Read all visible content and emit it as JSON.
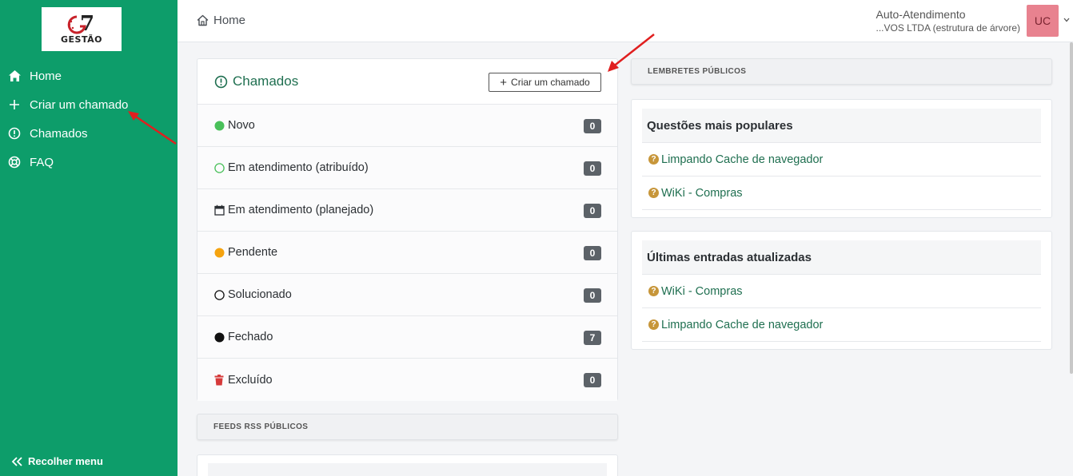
{
  "sidebar": {
    "logo_text": "GESTÃO",
    "logo_mark": "7",
    "items": [
      {
        "label": "Home",
        "icon": "home-icon"
      },
      {
        "label": "Criar um chamado",
        "icon": "plus-icon"
      },
      {
        "label": "Chamados",
        "icon": "alert-circle-icon"
      },
      {
        "label": "FAQ",
        "icon": "lifebuoy-icon"
      }
    ],
    "collapse_label": "Recolher menu"
  },
  "header": {
    "breadcrumb": "Home",
    "user_name": "Auto-Atendimento",
    "user_entity": "...VOS LTDA (estrutura de árvore)",
    "avatar_initials": "UC"
  },
  "tickets": {
    "title": "Chamados",
    "create_label": "Criar um chamado",
    "rows": [
      {
        "label": "Novo",
        "count": "0"
      },
      {
        "label": "Em atendimento (atribuído)",
        "count": "0"
      },
      {
        "label": "Em atendimento (planejado)",
        "count": "0"
      },
      {
        "label": "Pendente",
        "count": "0"
      },
      {
        "label": "Solucionado",
        "count": "0"
      },
      {
        "label": "Fechado",
        "count": "7"
      },
      {
        "label": "Excluído",
        "count": "0"
      }
    ]
  },
  "feeds": {
    "title": "FEEDS RSS PÚBLICOS"
  },
  "reminders": {
    "title": "LEMBRETES PÚBLICOS"
  },
  "faq_popular": {
    "title": "Questões mais populares",
    "items": [
      "Limpando Cache de navegador",
      "WiKi - Compras"
    ]
  },
  "faq_recent": {
    "title": "Últimas entradas atualizadas",
    "items": [
      "WiKi - Compras",
      "Limpando Cache de navegador"
    ]
  },
  "colors": {
    "sidebar": "#0d9d6a",
    "status_new": "#49c05a",
    "status_pending": "#f5a30f",
    "status_deleted": "#d63a3a",
    "annotation_arrow": "#e01f1f"
  }
}
